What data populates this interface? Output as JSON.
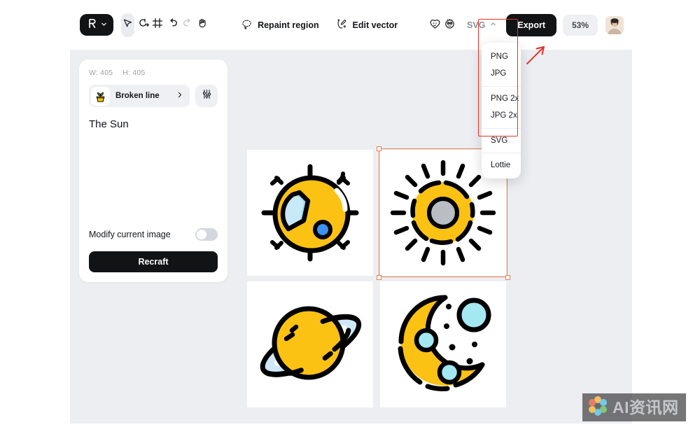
{
  "toolbar": {
    "brand_icon": "recraft-logo-icon",
    "brand_caret": "chevron-down-icon",
    "tools": [
      {
        "name": "select-tool",
        "icon": "cursor-arrow-icon",
        "active": true
      },
      {
        "name": "add-image-tool",
        "icon": "image-plus-icon",
        "active": false
      },
      {
        "name": "frame-tool",
        "icon": "crop-frame-icon",
        "active": false
      },
      {
        "name": "undo-tool",
        "icon": "undo-arrow-icon",
        "active": false
      },
      {
        "name": "redo-tool",
        "icon": "redo-arrow-icon",
        "active": false,
        "disabled": true
      },
      {
        "name": "hand-tool",
        "icon": "hand-icon",
        "active": false
      }
    ],
    "repaint_region_label": "Repaint region",
    "repaint_region_icon": "dashed-lasso-icon",
    "edit_vector_label": "Edit vector",
    "edit_vector_icon": "vector-pen-node-icon",
    "reaction_icons": [
      "winking-face-icon",
      "wide-eyed-face-icon"
    ],
    "format_select_value": "SVG",
    "format_select_caret": "chevron-up-icon",
    "export_label": "Export",
    "zoom_level": "53%",
    "avatar_name": "user-avatar"
  },
  "export_menu": {
    "groups": [
      [
        "PNG",
        "JPG"
      ],
      [
        "PNG 2x",
        "JPG 2x"
      ],
      [
        "SVG"
      ],
      [
        "Lottie"
      ]
    ],
    "highlight_color": "#e4322b",
    "arrow_color": "#e4322b"
  },
  "left_panel": {
    "width_label": "W: 405",
    "height_label": "H: 405",
    "style_icon": "potted-plant-icon",
    "style_name": "Broken line",
    "style_chevron": "chevron-right-icon",
    "settings_icon": "sliders-icon",
    "prompt": "The Sun",
    "modify_label": "Modify current image",
    "modify_enabled": false,
    "recraft_label": "Recraft"
  },
  "canvas": {
    "background": "#eceef2",
    "selection_color": "#ef7e47",
    "tiles": [
      {
        "name": "art-tile-sun-eclipse",
        "alt": "sun with blue crescent bite",
        "selected": false
      },
      {
        "name": "art-tile-sun-ring",
        "alt": "sun with rays and gray center",
        "selected": true
      },
      {
        "name": "art-tile-saturn",
        "alt": "yellow planet with ring",
        "selected": false
      },
      {
        "name": "art-tile-moon",
        "alt": "crescent moon with stars",
        "selected": false
      }
    ],
    "palette": {
      "yellow": "#fbc214",
      "black": "#000000",
      "light_blue": "#9ed9f0",
      "blue": "#3b92f0",
      "gray": "#b8bec4",
      "cyan": "#a4e8f2"
    }
  },
  "watermark": {
    "text": "AI资讯网",
    "logo_icon": "flower-logo-icon"
  }
}
